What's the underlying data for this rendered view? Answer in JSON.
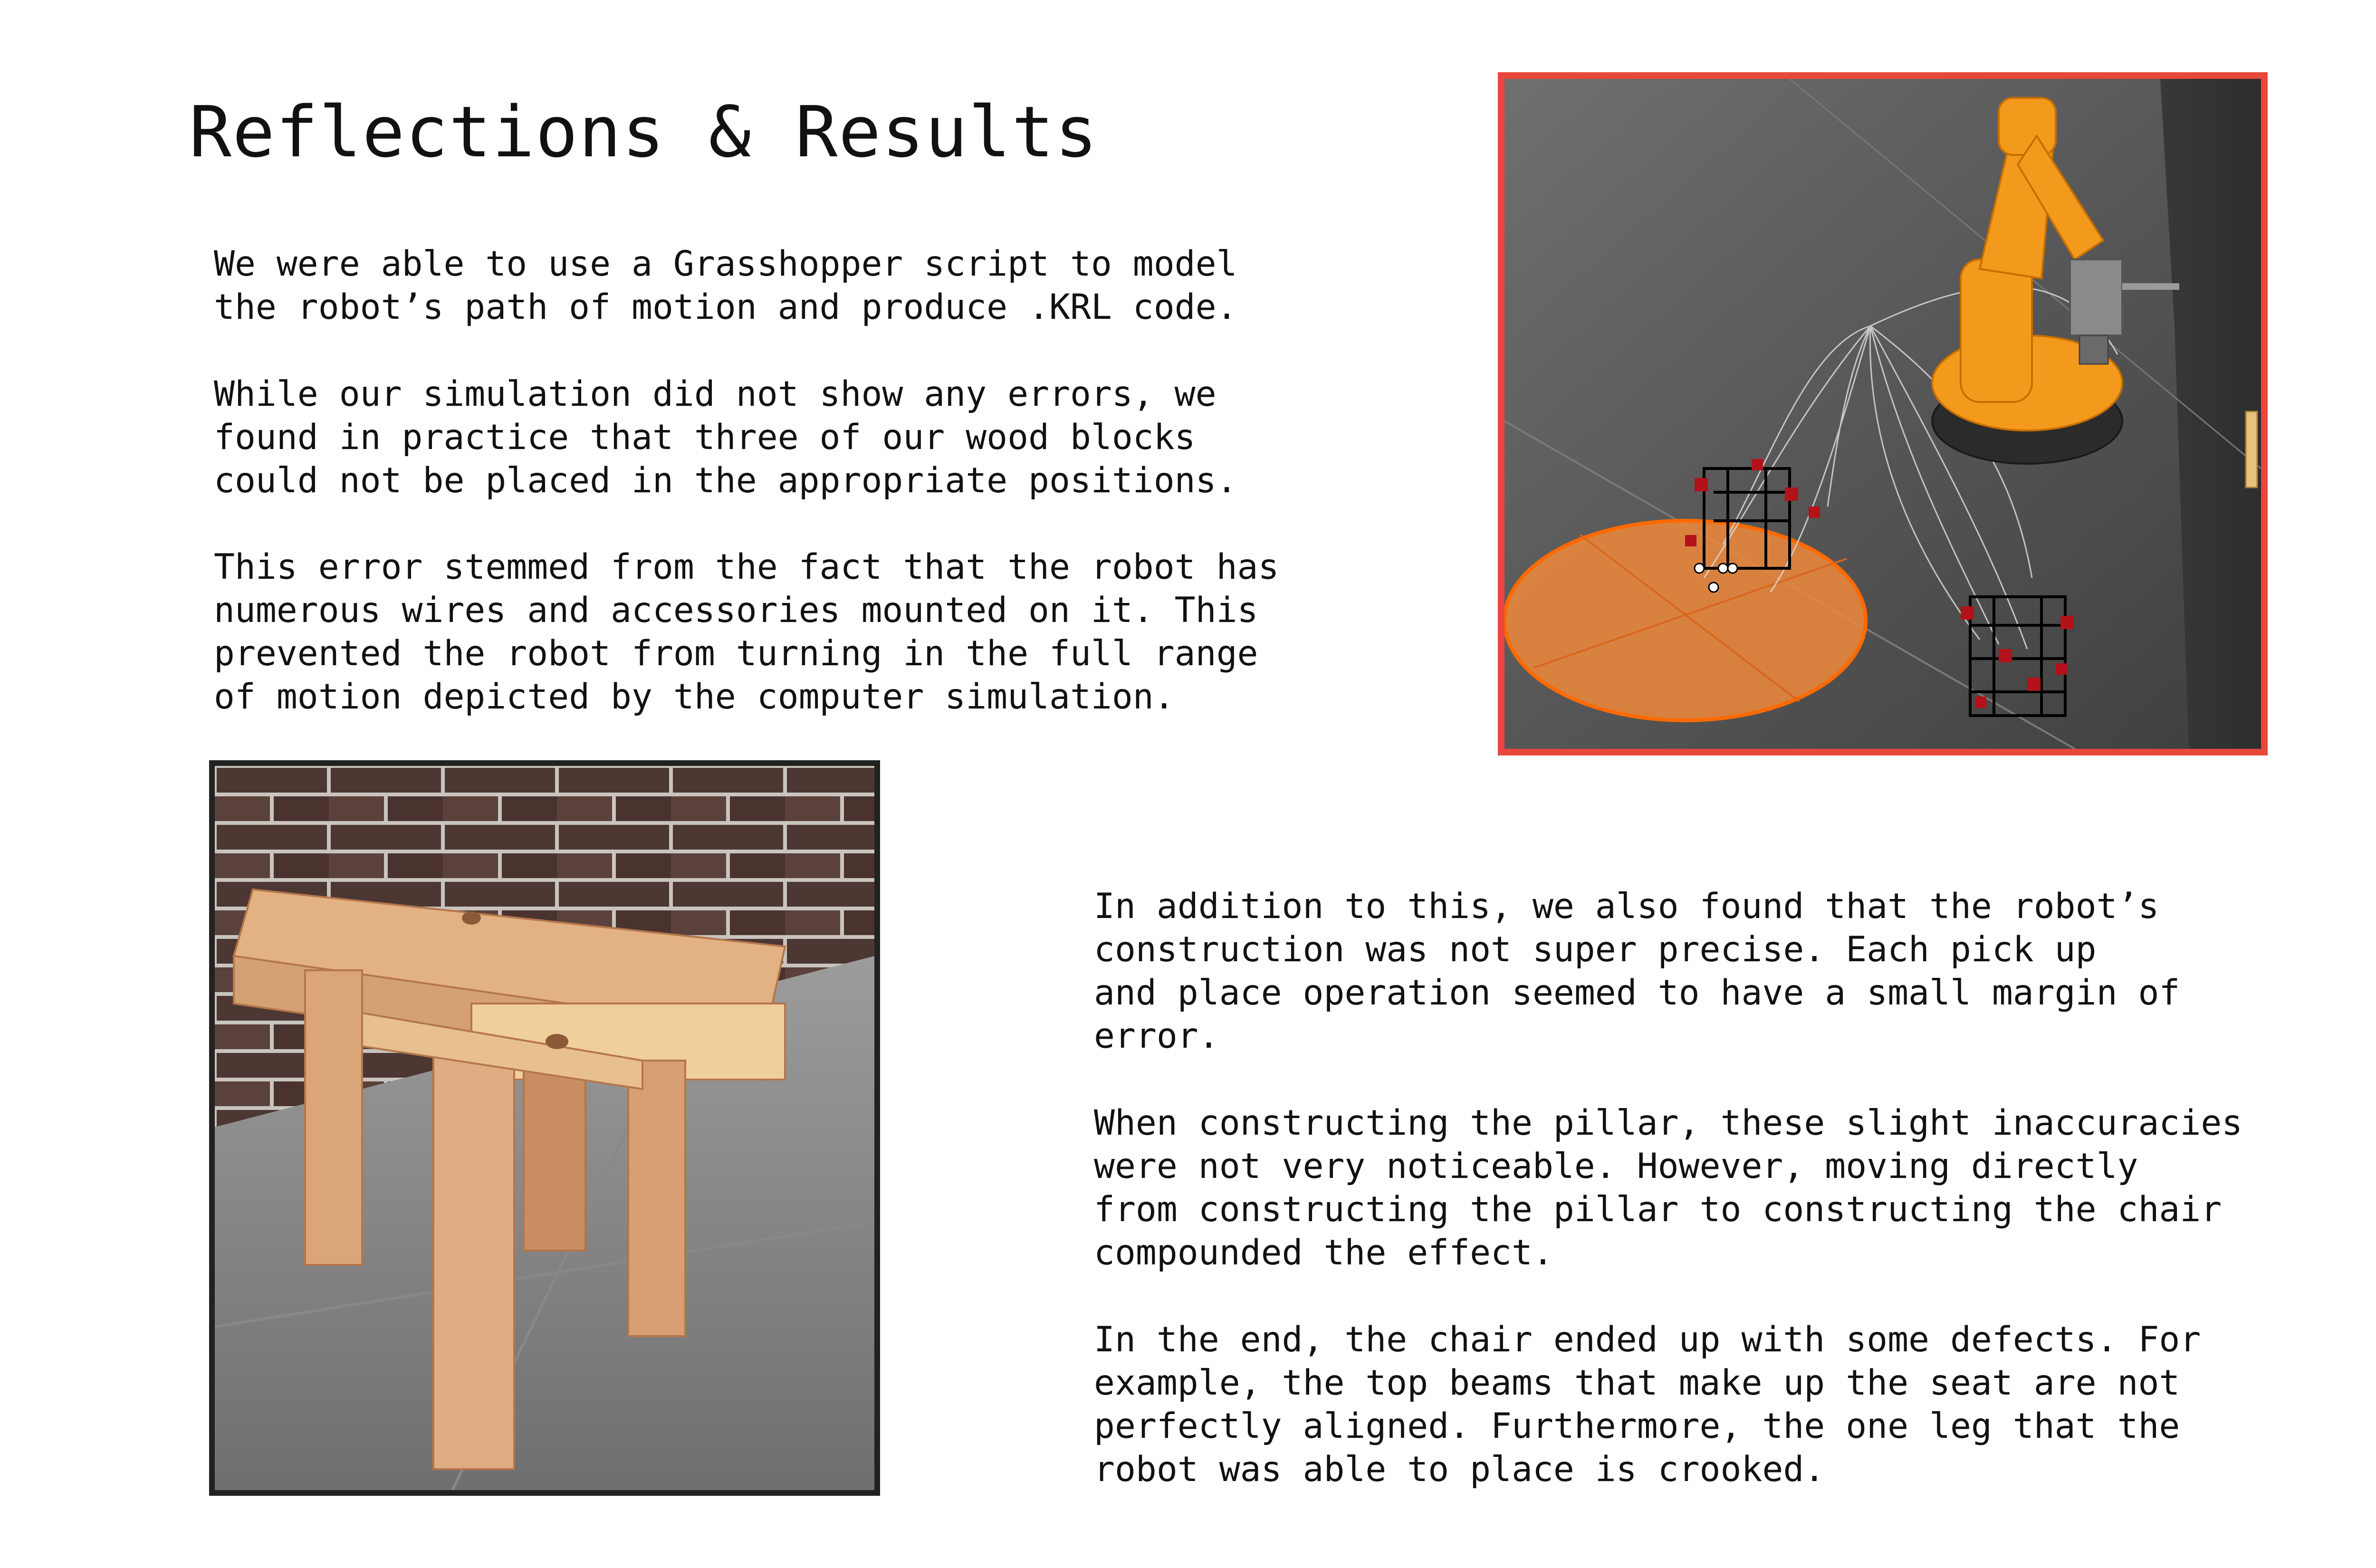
{
  "page": {
    "title": "Reflections & Results",
    "left_column": {
      "paragraph_1": "We were able to use a Grasshopper script to model\nthe robot’s path of motion and produce .KRL code.",
      "paragraph_2": "While our simulation did not show any errors, we\nfound in practice that three of our wood blocks\ncould not be placed in the appropriate positions.",
      "paragraph_3": "This error stemmed from the fact that the robot has\nnumerous wires and accessories mounted on it. This\nprevented the robot from turning in the full range\nof motion depicted by the computer simulation."
    },
    "right_column": {
      "paragraph_1": "In addition to this, we also found that the robot’s\nconstruction was not super precise. Each pick up\nand place operation seemed to have a small margin of\nerror.",
      "paragraph_2": "When constructing the pillar, these slight inaccuracies\nwere not very noticeable. However, moving directly\nfrom constructing the pillar to constructing the chair\ncompounded the effect.",
      "paragraph_3": "In the end, the chair ended up with some defects. For\nexample, the top beams that make up the seat are not\nperfectly aligned. Furthermore, the one leg that the\nrobot was able to place is crooked."
    }
  },
  "colors": {
    "simulation_border": "#e8473a",
    "photo_border": "#222222",
    "robot_orange": "#f39a1c",
    "platform_orange": "#f08a3c"
  }
}
